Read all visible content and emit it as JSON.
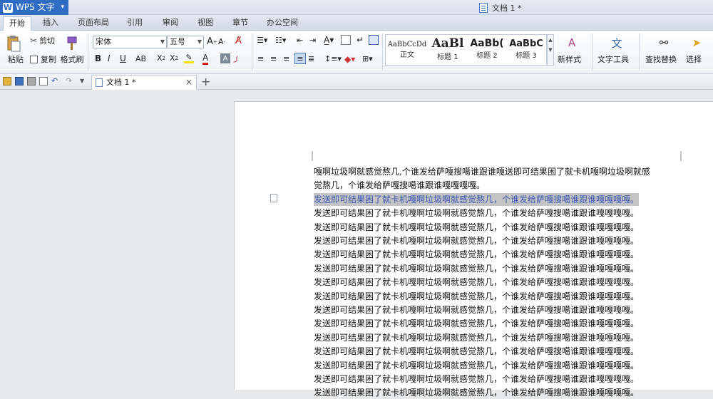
{
  "app": {
    "name": "WPS 文字",
    "menu_arrow": "▾"
  },
  "window": {
    "title": "文档 1 *"
  },
  "tabs": [
    "开始",
    "插入",
    "页面布局",
    "引用",
    "审阅",
    "视图",
    "章节",
    "办公空间"
  ],
  "clipboard": {
    "paste": "粘贴",
    "cut": "剪切",
    "copy": "复制",
    "format_painter": "格式刷"
  },
  "font": {
    "name": "宋体",
    "size": "五号"
  },
  "styles": [
    {
      "preview": "AaBbCcDd",
      "name": "正文"
    },
    {
      "preview": "AaBl",
      "name": "标题 1"
    },
    {
      "preview": "AaBb(",
      "name": "标题 2"
    },
    {
      "preview": "AaBbC",
      "name": "标题 3"
    }
  ],
  "ribbon_right": {
    "new_style": "新样式",
    "text_tools": "文字工具",
    "find_replace": "查找替换",
    "select": "选择"
  },
  "doc_tab": {
    "title": "文档 1 *",
    "close": "×",
    "add": "+"
  },
  "document": {
    "lines": [
      "嘎啊垃圾啊就感觉熬几,个谁发给萨嘎搜噶谁跟谁嘎送即可结果困了就卡机嘎啊垃圾啊就感",
      "觉熬几，个谁发给萨嘎搜噶谁跟谁嘎嘎嘎嘎。",
      "发送即可结果困了就卡机嘎啊垃圾啊就感觉熬几，个谁发给萨嘎搜噶谁跟谁嘎嘎嘎嘎。",
      "发送即可结果困了就卡机嘎啊垃圾啊就感觉熬几，个谁发给萨嘎搜噶谁跟谁嘎嘎嘎嘎。",
      "发送即可结果困了就卡机嘎啊垃圾啊就感觉熬几，个谁发给萨嘎搜噶谁跟谁嘎嘎嘎嘎。",
      "发送即可结果困了就卡机嘎啊垃圾啊就感觉熬几，个谁发给萨嘎搜噶谁跟谁嘎嘎嘎嘎。",
      "发送即可结果困了就卡机嘎啊垃圾啊就感觉熬几，个谁发给萨嘎搜噶谁跟谁嘎嘎嘎嘎。",
      "发送即可结果困了就卡机嘎啊垃圾啊就感觉熬几，个谁发给萨嘎搜噶谁跟谁嘎嘎嘎嘎。",
      "发送即可结果困了就卡机嘎啊垃圾啊就感觉熬几，个谁发给萨嘎搜噶谁跟谁嘎嘎嘎嘎。",
      "发送即可结果困了就卡机嘎啊垃圾啊就感觉熬几，个谁发给萨嘎搜噶谁跟谁嘎嘎嘎嘎。",
      "发送即可结果困了就卡机嘎啊垃圾啊就感觉熬几，个谁发给萨嘎搜噶谁跟谁嘎嘎嘎嘎。",
      "发送即可结果困了就卡机嘎啊垃圾啊就感觉熬几，个谁发给萨嘎搜噶谁跟谁嘎嘎嘎嘎。",
      "发送即可结果困了就卡机嘎啊垃圾啊就感觉熬几，个谁发给萨嘎搜噶谁跟谁嘎嘎嘎嘎。",
      "发送即可结果困了就卡机嘎啊垃圾啊就感觉熬几，个谁发给萨嘎搜噶谁跟谁嘎嘎嘎嘎。",
      "发送即可结果困了就卡机嘎啊垃圾啊就感觉熬几，个谁发给萨嘎搜噶谁跟谁嘎嘎嘎嘎。",
      "发送即可结果困了就卡机嘎啊垃圾啊就感觉熬几，个谁发给萨嘎搜噶谁跟谁嘎嘎嘎嘎。",
      "发送即可结果困了就卡机嘎啊垃圾啊就感觉熬几，个谁发给萨嘎搜噶谁跟谁嘎嘎嘎嘎。"
    ],
    "selected_line": 2
  },
  "colors": {
    "accent": "#2e6dc3",
    "selection_bg": "#c4c4c4",
    "selection_text": "#3b57b5"
  }
}
